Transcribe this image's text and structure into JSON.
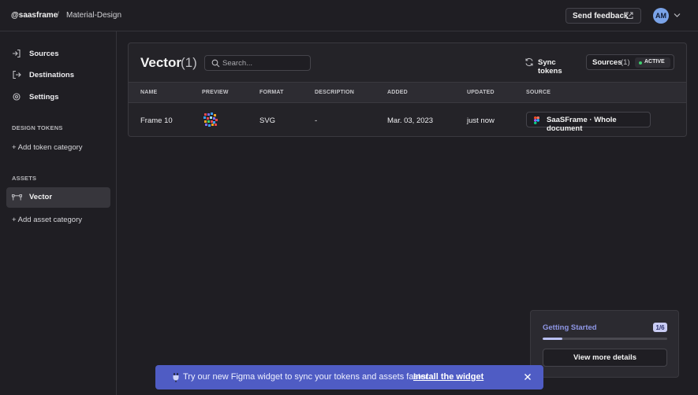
{
  "header": {
    "workspace": "@saasframe",
    "separator": "/",
    "project": "Material-Design",
    "feedback_label": "Send feedback",
    "avatar_initials": "AM"
  },
  "sidebar": {
    "nav": [
      {
        "label": "Sources",
        "icon": "sign-in-icon"
      },
      {
        "label": "Destinations",
        "icon": "sign-out-icon"
      },
      {
        "label": "Settings",
        "icon": "gear-icon"
      }
    ],
    "design_tokens_heading": "DESIGN TOKENS",
    "add_token_category": "+ Add token category",
    "assets_heading": "ASSETS",
    "active_asset": "Vector",
    "add_asset_category": "+ Add asset category"
  },
  "main": {
    "title": "Vector",
    "count": "(1)",
    "search_placeholder": "Search...",
    "sync_label": "Sync tokens",
    "sources_label": "Sources",
    "sources_count": "(1)",
    "active_badge": "ACTIVE",
    "columns": [
      "NAME",
      "PREVIEW",
      "FORMAT",
      "DESCRIPTION",
      "ADDED",
      "UPDATED",
      "SOURCE"
    ],
    "rows": [
      {
        "name": "Frame 10",
        "format": "SVG",
        "description": "-",
        "added": "Mar. 03, 2023",
        "updated": "just now",
        "source": "SaaSFrame · Whole document"
      }
    ]
  },
  "getting_started": {
    "title": "Getting Started",
    "step": "1/6",
    "progress": 0.16,
    "button_label": "View more details"
  },
  "banner": {
    "message": "Try our new Figma widget to sync your tokens and assets faster",
    "cta": "Install the widget"
  },
  "colors": {
    "accent": "#4f5cc4",
    "active_dot": "#3ecf6e",
    "avatar": "#7aa3e8"
  }
}
